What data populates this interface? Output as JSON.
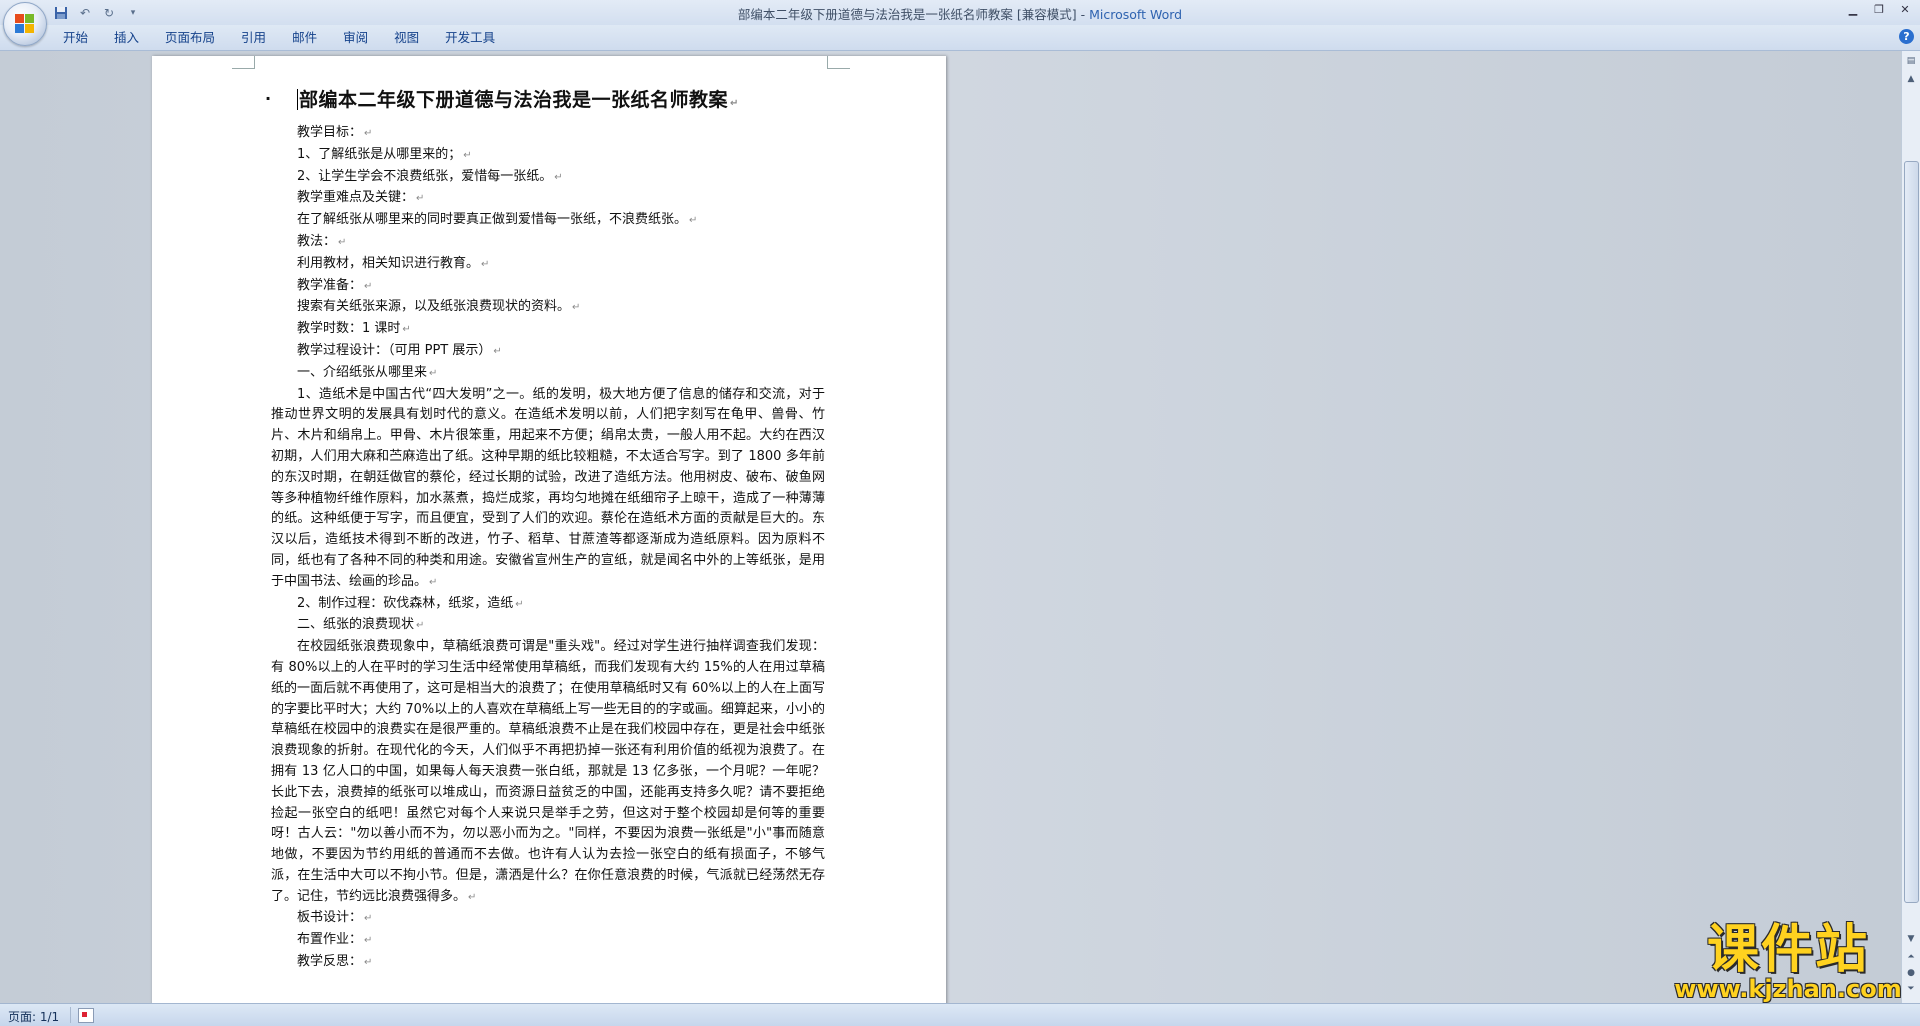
{
  "window": {
    "title_doc": "部编本二年级下册道德与法治我是一张纸名师教案",
    "title_mode": "[兼容模式]",
    "title_app": "Microsoft Word",
    "separator": " - "
  },
  "quick_access": {
    "icons": [
      "save-icon",
      "undo-icon",
      "redo-icon",
      "customize-icon"
    ]
  },
  "ribbon": {
    "tabs": [
      "开始",
      "插入",
      "页面布局",
      "引用",
      "邮件",
      "审阅",
      "视图",
      "开发工具"
    ],
    "help": "?"
  },
  "document": {
    "title": "部编本二年级下册道德与法治我是一张纸名师教案",
    "paragraph_mark": "↵",
    "lines": [
      "教学目标：",
      "1、了解纸张是从哪里来的；",
      "2、让学生学会不浪费纸张，爱惜每一张纸。",
      "教学重难点及关键：",
      "在了解纸张从哪里来的同时要真正做到爱惜每一张纸，不浪费纸张。",
      "教法：",
      "利用教材，相关知识进行教育。",
      "教学准备：",
      "搜索有关纸张来源，以及纸张浪费现状的资料。",
      "教学时数：1 课时",
      "教学过程设计：（可用 PPT 展示）",
      "一、介绍纸张从哪里来"
    ],
    "para1": "1、造纸术是中国古代“四大发明”之一。纸的发明，极大地方便了信息的储存和交流，对于推动世界文明的发展具有划时代的意义。在造纸术发明以前，人们把字刻写在龟甲、兽骨、竹片、木片和绢帛上。甲骨、木片很笨重，用起来不方便；绢帛太贵，一般人用不起。大约在西汉初期，人们用大麻和苎麻造出了纸。这种早期的纸比较粗糙，不太适合写字。到了 1800 多年前的东汉时期，在朝廷做官的蔡伦，经过长期的试验，改进了造纸方法。他用树皮、破布、破鱼网等多种植物纤维作原料，加水蒸煮，捣烂成浆，再均匀地摊在纸细帘子上晾干，造成了一种薄薄的纸。这种纸便于写字，而且便宜，受到了人们的欢迎。蔡伦在造纸术方面的贡献是巨大的。东汉以后，造纸技术得到不断的改进，竹子、稻草、甘蔗渣等都逐渐成为造纸原料。因为原料不同，纸也有了各种不同的种类和用途。安徽省宣州生产的宣纸，就是闻名中外的上等纸张，是用于中国书法、绘画的珍品。",
    "lines2": [
      "2、制作过程：砍伐森林，纸浆，造纸",
      "二、纸张的浪费现状"
    ],
    "para2": "在校园纸张浪费现象中，草稿纸浪费可谓是\"重头戏\"。经过对学生进行抽样调查我们发现：有 80%以上的人在平时的学习生活中经常使用草稿纸，而我们发现有大约 15%的人在用过草稿纸的一面后就不再使用了，这可是相当大的浪费了；在使用草稿纸时又有 60%以上的人在上面写的字要比平时大；大约 70%以上的人喜欢在草稿纸上写一些无目的的字或画。细算起来，小小的草稿纸在校园中的浪费实在是很严重的。草稿纸浪费不止是在我们校园中存在，更是社会中纸张浪费现象的折射。在现代化的今天，人们似乎不再把扔掉一张还有利用价值的纸视为浪费了。在拥有 13 亿人口的中国，如果每人每天浪费一张白纸，那就是 13 亿多张，一个月呢？一年呢？长此下去，浪费掉的纸张可以堆成山，而资源日益贫乏的中国，还能再支持多久呢？请不要拒绝捡起一张空白的纸吧！虽然它对每个人来说只是举手之劳，但这对于整个校园却是何等的重要呀！古人云：\"勿以善小而不为，勿以恶小而为之。\"同样，不要因为浪费一张纸是\"小\"事而随意地做，不要因为节约用纸的普通而不去做。也许有人认为去捡一张空白的纸有损面子，不够气派，在生活中大可以不拘小节。但是，潇洒是什么？在你任意浪费的时候，气派就已经荡然无存了。记住，节约远比浪费强得多。",
    "lines3": [
      "板书设计：",
      "布置作业：",
      "教学反思："
    ]
  },
  "statusbar": {
    "page": "页面: 1/1"
  },
  "watermark": {
    "brand": "课件站",
    "url": "www.kjzhan.com"
  }
}
